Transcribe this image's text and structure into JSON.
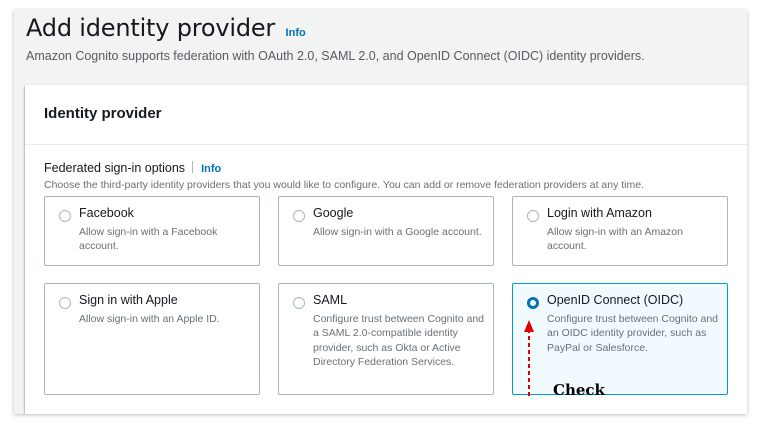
{
  "page": {
    "title": "Add identity provider",
    "info": "Info",
    "description": "Amazon Cognito supports federation with OAuth 2.0, SAML 2.0, and OpenID Connect (OIDC) identity providers."
  },
  "container": {
    "title": "Identity provider",
    "field_label": "Federated sign-in options",
    "field_info": "Info",
    "field_description": "Choose the third-party identity providers that you would like to configure. You can add or remove federation providers at any time."
  },
  "providers": [
    {
      "label": "Facebook",
      "description": "Allow sign-in with a Facebook account.",
      "selected": false
    },
    {
      "label": "Google",
      "description": "Allow sign-in with a Google account.",
      "selected": false
    },
    {
      "label": "Login with Amazon",
      "description": "Allow sign-in with an Amazon account.",
      "selected": false
    },
    {
      "label": "Sign in with Apple",
      "description": "Allow sign-in with an Apple ID.",
      "selected": false
    },
    {
      "label": "SAML",
      "description": "Configure trust between Cognito and a SAML 2.0-compatible identity provider, such as Okta or Active Directory Federation Services.",
      "selected": false
    },
    {
      "label": "OpenID Connect (OIDC)",
      "description": "Configure trust between Cognito and an OIDC identity provider, such as PayPal or Salesforce.",
      "selected": true
    }
  ],
  "annotation": {
    "text": "Check",
    "color": "#e00000"
  },
  "colors": {
    "link": "#0073bb",
    "selected_border": "#00a1c9",
    "selected_bg": "#f1faff"
  }
}
